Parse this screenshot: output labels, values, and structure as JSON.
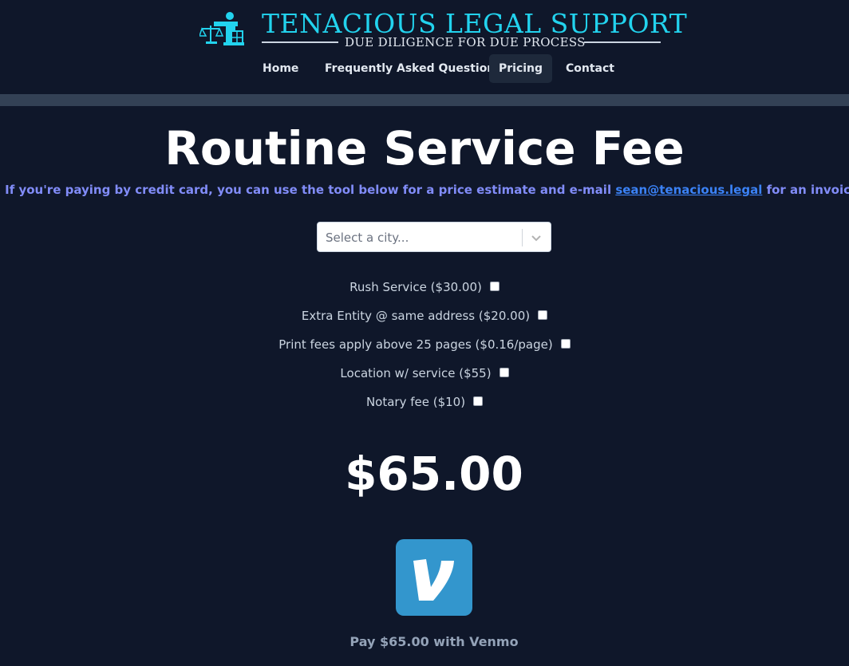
{
  "brand": {
    "title": "TENACIOUS LEGAL SUPPORT",
    "tagline": "DUE DILIGENCE FOR DUE PROCESS",
    "accent_color": "#22d3ee",
    "icon": "scales-of-justice-icon"
  },
  "nav": {
    "items": [
      {
        "label": "Home",
        "active": false
      },
      {
        "label": "Frequently Asked Questions",
        "active": false
      },
      {
        "label": "Pricing",
        "active": true
      },
      {
        "label": "Contact",
        "active": false
      }
    ]
  },
  "page": {
    "title": "Routine Service Fee",
    "intro_prefix": "If you're paying by credit card, you can use the tool below for a price estimate and e-mail",
    "intro_email": "sean@tenacious.legal",
    "intro_suffix": "for an invoice."
  },
  "city_select": {
    "placeholder": "Select a city...",
    "icon": "chevron-down-icon"
  },
  "options": [
    {
      "label": "Rush Service ($30.00)",
      "checked": false
    },
    {
      "label": "Extra Entity @ same address ($20.00)",
      "checked": false
    },
    {
      "label": "Print fees apply above 25 pages ($0.16/page)",
      "checked": false
    },
    {
      "label": "Location w/ service ($55)",
      "checked": false
    },
    {
      "label": "Notary fee ($10)",
      "checked": false
    }
  ],
  "total": {
    "amount": "$65.00"
  },
  "payment": {
    "icon": "venmo-logo-icon",
    "brand_color": "#3396cd",
    "label": "Pay $65.00 with Venmo"
  }
}
